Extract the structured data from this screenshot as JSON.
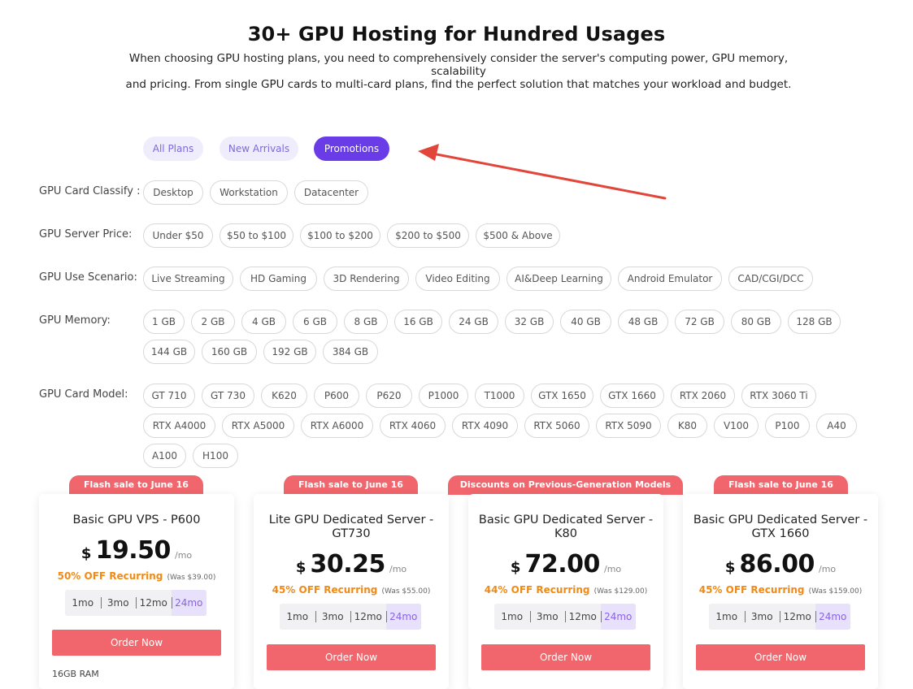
{
  "header": {
    "title": "30+ GPU Hosting for Hundred Usages",
    "subtitle_line1": "When choosing GPU hosting plans, you need to comprehensively consider the server's computing power, GPU memory, scalability",
    "subtitle_line2": "and pricing. From single GPU cards to multi-card plans, find the perfect solution that matches your workload and budget."
  },
  "tabs": [
    {
      "label": "All Plans",
      "active": false
    },
    {
      "label": "New Arrivals",
      "active": false
    },
    {
      "label": "Promotions",
      "active": true
    }
  ],
  "annotation": {
    "arrow_color": "#e2453a"
  },
  "filters": {
    "card_classify": {
      "label": "GPU Card Classify :",
      "options": [
        "Desktop",
        "Workstation",
        "Datacenter"
      ]
    },
    "server_price": {
      "label": "GPU Server Price:",
      "options": [
        "Under $50",
        "$50 to $100",
        "$100 to $200",
        "$200 to $500",
        "$500 & Above"
      ]
    },
    "use_scenario": {
      "label": "GPU Use Scenario:",
      "options": [
        "Live Streaming",
        "HD Gaming",
        "3D Rendering",
        "Video Editing",
        "AI&Deep Learning",
        "Android Emulator",
        "CAD/CGI/DCC"
      ]
    },
    "memory": {
      "label": "GPU Memory:",
      "options": [
        "1 GB",
        "2 GB",
        "4 GB",
        "6 GB",
        "8 GB",
        "16 GB",
        "24 GB",
        "32 GB",
        "40 GB",
        "48 GB",
        "72 GB",
        "80 GB",
        "128 GB",
        "144 GB",
        "160 GB",
        "192 GB",
        "384 GB"
      ]
    },
    "card_model": {
      "label": "GPU Card Model:",
      "options": [
        "GT 710",
        "GT 730",
        "K620",
        "P600",
        "P620",
        "P1000",
        "T1000",
        "GTX 1650",
        "GTX 1660",
        "RTX 2060",
        "RTX 3060 Ti",
        "RTX A4000",
        "RTX A5000",
        "RTX A6000",
        "RTX 4060",
        "RTX 4090",
        "RTX 5060",
        "RTX 5090",
        "K80",
        "V100",
        "P100",
        "A40",
        "A100",
        "H100"
      ]
    }
  },
  "plans": [
    {
      "ribbon": "Flash sale to June 16",
      "title": "Basic GPU VPS - P600",
      "currency": "$",
      "price": "19.50",
      "per": "/mo",
      "discount": "50% OFF Recurring",
      "was": "(Was $39.00)",
      "periods": [
        "1mo",
        "3mo",
        "12mo",
        "24mo"
      ],
      "selected_period": "24mo",
      "order_label": "Order Now",
      "spec": "16GB RAM"
    },
    {
      "ribbon": "Flash sale to June 16",
      "title": "Lite GPU Dedicated Server - GT730",
      "currency": "$",
      "price": "30.25",
      "per": "/mo",
      "discount": "45% OFF Recurring",
      "was": "(Was $55.00)",
      "periods": [
        "1mo",
        "3mo",
        "12mo",
        "24mo"
      ],
      "selected_period": "24mo",
      "order_label": "Order Now"
    },
    {
      "ribbon": "Discounts on Previous-Generation Models",
      "title": "Basic GPU Dedicated Server - K80",
      "currency": "$",
      "price": "72.00",
      "per": "/mo",
      "discount": "44% OFF Recurring",
      "was": "(Was $129.00)",
      "periods": [
        "1mo",
        "3mo",
        "12mo",
        "24mo"
      ],
      "selected_period": "24mo",
      "order_label": "Order Now"
    },
    {
      "ribbon": "Flash sale to June 16",
      "title": "Basic GPU Dedicated Server - GTX 1660",
      "currency": "$",
      "price": "86.00",
      "per": "/mo",
      "discount": "45% OFF Recurring",
      "was": "(Was $159.00)",
      "periods": [
        "1mo",
        "3mo",
        "12mo",
        "24mo"
      ],
      "selected_period": "24mo",
      "order_label": "Order Now"
    }
  ]
}
